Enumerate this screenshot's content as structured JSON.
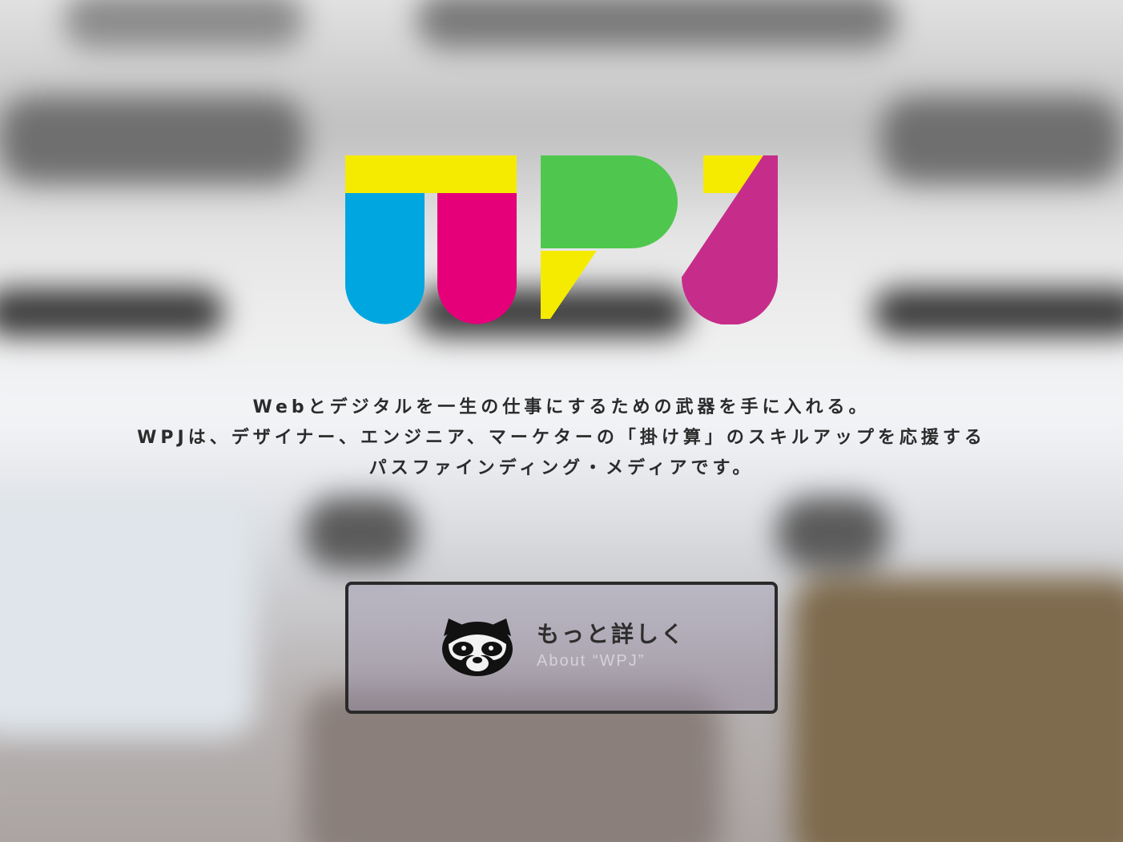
{
  "tagline": {
    "line1": "Webとデジタルを一生の仕事にするための武器を手に入れる。",
    "line2": "WPJは、デザイナー、エンジニア、マーケターの「掛け算」のスキルアップを応援する",
    "line3": "パスファインディング・メディアです。"
  },
  "about_button": {
    "title": "もっと詳しく",
    "subtitle": "About “WPJ”",
    "icon": "raccoon-icon"
  },
  "logo": {
    "alt": "WPJ",
    "colors": {
      "yellow": "#F5EB00",
      "cyan": "#00A6E0",
      "magenta": "#E5007A",
      "green": "#4FC74E",
      "purple": "#C62D8B"
    }
  }
}
